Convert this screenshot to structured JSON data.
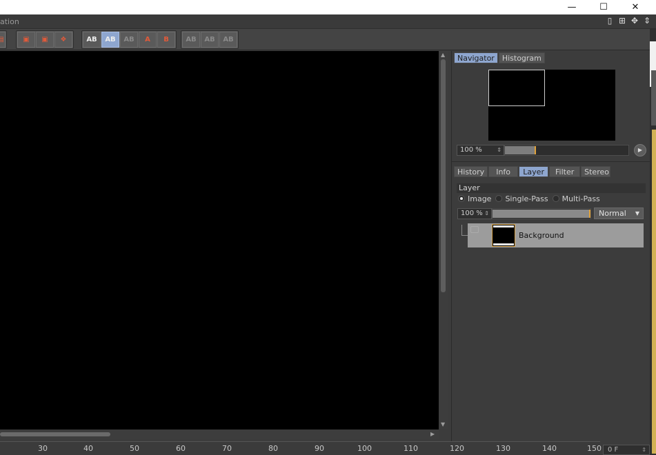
{
  "window": {
    "minimize_glyph": "—",
    "maximize_glyph": "☐",
    "close_glyph": "✕",
    "title_partial": "ation"
  },
  "layout_icons": [
    "▯",
    "⊞",
    "✥",
    "⇕"
  ],
  "toolbar": {
    "groups": [
      [
        "save-image",
        "render-region",
        "render-view",
        "render-all"
      ],
      [
        "ab-compare",
        "ab-swap-active",
        "ab-split",
        "set-a",
        "set-b"
      ],
      [
        "ab-left",
        "ab-mid",
        "ab-right"
      ]
    ],
    "set_a_label": "A",
    "set_b_label": "B",
    "ab_label": "AB"
  },
  "ruler": {
    "ticks": [
      "30",
      "40",
      "50",
      "60",
      "70",
      "80",
      "90",
      "100",
      "110",
      "120",
      "130",
      "140",
      "150"
    ],
    "frame_value": "0 F",
    "frame_spin": "⇕"
  },
  "panel_top": {
    "tabs": [
      "Navigator",
      "Histogram"
    ],
    "active_tab": "Navigator",
    "zoom_value": "100 %",
    "zoom_spin": "⇕",
    "zoom_fraction": 0.24,
    "play_glyph": "▶"
  },
  "panel_bottom": {
    "tabs": [
      "History",
      "Info",
      "Layer",
      "Filter",
      "Stereo"
    ],
    "active_tab": "Layer",
    "section_title": "Layer",
    "radio_options": [
      "Image",
      "Single-Pass",
      "Multi-Pass"
    ],
    "selected_radio": "Image",
    "opacity_value": "100 %",
    "opacity_spin": "⇕",
    "blend_mode": "Normal",
    "layers": [
      {
        "name": "Background"
      }
    ]
  },
  "colors": {
    "accent_tab": "#8ea6cf",
    "slider_knob": "#e0a23a",
    "panel_bg": "#3c3c3c"
  }
}
